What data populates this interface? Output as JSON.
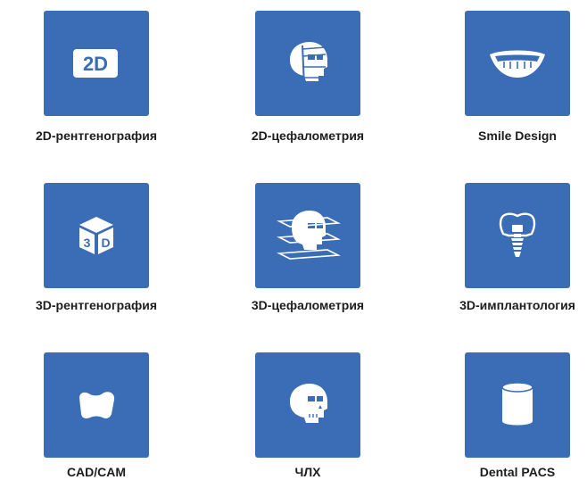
{
  "tiles": [
    {
      "label": "2D-рентгенография",
      "icon": "2d-badge-icon",
      "badge": "2D"
    },
    {
      "label": "2D-цефалометрия",
      "icon": "skull-caliper-icon"
    },
    {
      "label": "Smile Design",
      "icon": "smile-icon"
    },
    {
      "label": "3D-рентгенография",
      "icon": "3d-cube-icon"
    },
    {
      "label": "3D-цефалометрия",
      "icon": "skull-layers-icon"
    },
    {
      "label": "3D-имплантология",
      "icon": "dental-implant-icon"
    },
    {
      "label": "CAD/CAM",
      "icon": "tooth-crown-icon"
    },
    {
      "label": "ЧЛХ",
      "icon": "skull-icon"
    },
    {
      "label": "Dental PACS",
      "icon": "database-cylinder-icon"
    }
  ],
  "colors": {
    "tile": "#3a6db5",
    "icon": "#ffffff",
    "label": "#1d1d1f"
  }
}
